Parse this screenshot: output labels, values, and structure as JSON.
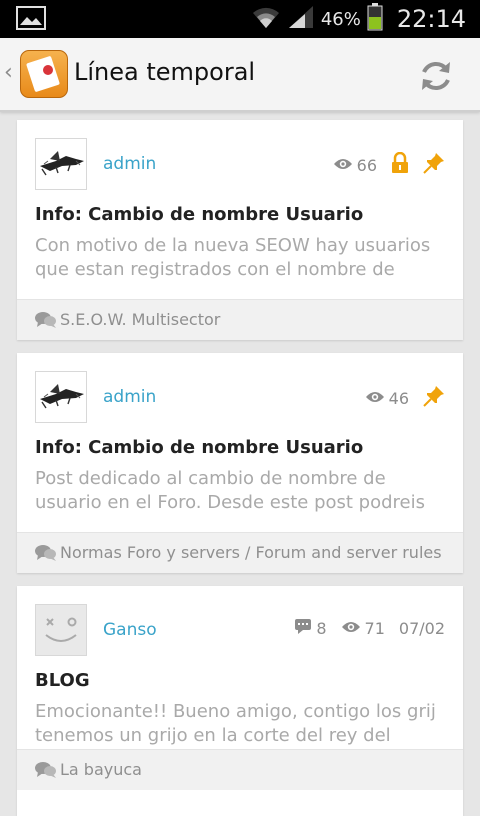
{
  "status_bar": {
    "battery_percent": "46%",
    "time": "22:14"
  },
  "app_bar": {
    "title": "Línea temporal"
  },
  "posts": [
    {
      "author": "admin",
      "views": "66",
      "locked": true,
      "pinned": true,
      "comments": null,
      "date": null,
      "title": "Info: Cambio de nombre Usuario",
      "excerpt": "Con motivo de la nueva SEOW hay usuarios que estan registrados con el nombre de",
      "forum": "S.E.O.W. Multisector"
    },
    {
      "author": "admin",
      "views": "46",
      "locked": false,
      "pinned": true,
      "comments": null,
      "date": null,
      "title": "Info: Cambio de nombre Usuario",
      "excerpt": "Post dedicado al cambio de nombre de usuario en el Foro.  Desde este post podreis",
      "forum": "Normas Foro y servers / Forum and server rules"
    },
    {
      "author": "Ganso",
      "views": "71",
      "locked": false,
      "pinned": false,
      "comments": "8",
      "date": "07/02",
      "title": "BLOG",
      "excerpt": "Emocionante!! Bueno amigo, contigo los grij tenemos un grijo en la corte del rey del",
      "forum": "La bayuca"
    }
  ]
}
